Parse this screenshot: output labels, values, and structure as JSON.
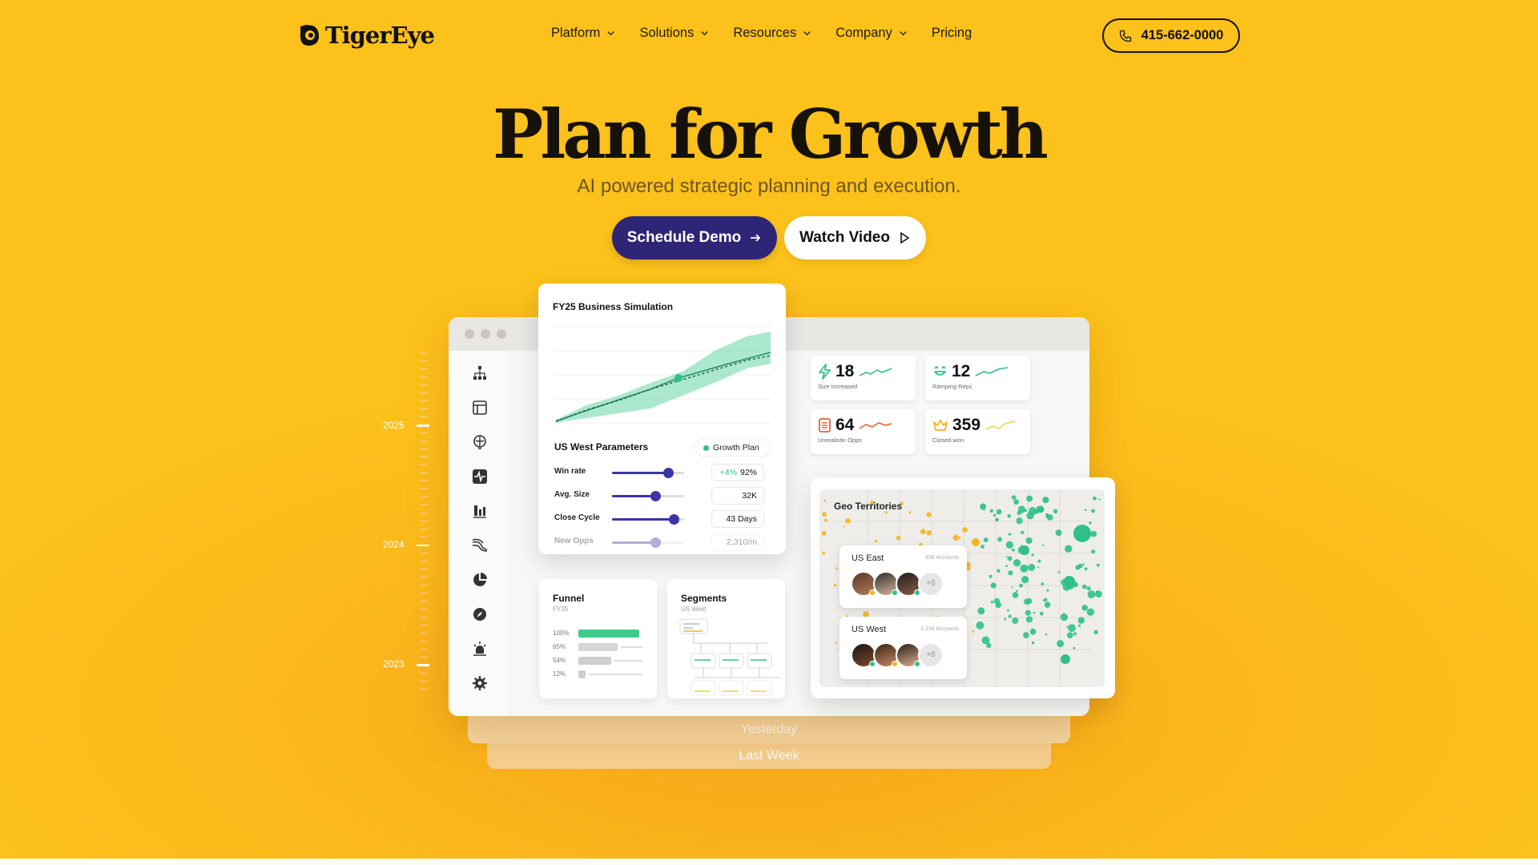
{
  "brand": {
    "name": "TigerEye"
  },
  "nav": {
    "items": [
      {
        "label": "Platform",
        "has_dropdown": true
      },
      {
        "label": "Solutions",
        "has_dropdown": true
      },
      {
        "label": "Resources",
        "has_dropdown": true
      },
      {
        "label": "Company",
        "has_dropdown": true
      },
      {
        "label": "Pricing",
        "has_dropdown": false
      }
    ],
    "phone": "415-662-0000"
  },
  "hero": {
    "title": "Plan for Growth",
    "subtitle": "AI powered strategic planning and execution.",
    "primary_cta": "Schedule Demo",
    "secondary_cta": "Watch Video"
  },
  "timeline": {
    "years": [
      "2025",
      "2024",
      "2023"
    ]
  },
  "history": {
    "labels": [
      "Yesterday",
      "Last Week"
    ]
  },
  "simulation": {
    "title": "FY25 Business Simulation",
    "params_title": "US West Parameters",
    "legend": "Growth Plan",
    "params": [
      {
        "label": "Win rate",
        "delta": "+4%",
        "value": "92%",
        "level": 0.78
      },
      {
        "label": "Avg. Size",
        "delta": "",
        "value": "32K",
        "level": 0.6
      },
      {
        "label": "Close Cycle",
        "delta": "",
        "value": "43 Days",
        "level": 0.86
      },
      {
        "label": "New Opps",
        "delta": "",
        "value": "2,310/m",
        "level": 0.6
      }
    ]
  },
  "stats": [
    {
      "value": "18",
      "label": "Size increased",
      "icon": "lightning-icon",
      "color": "#2fc08a"
    },
    {
      "value": "12",
      "label": "Ramping Reps",
      "icon": "smile-icon",
      "color": "#2fc08a"
    },
    {
      "value": "64",
      "label": "Unrealistic Opps",
      "icon": "document-icon",
      "color": "#e8642c"
    },
    {
      "value": "359",
      "label": "Closed won",
      "icon": "crown-icon",
      "color": "#f2b51c"
    }
  ],
  "funnel": {
    "title": "Funnel",
    "subtitle": "FY25",
    "rows": [
      {
        "label": "100%",
        "fraction": 1.0
      },
      {
        "label": "65%",
        "fraction": 0.65
      },
      {
        "label": "54%",
        "fraction": 0.54
      },
      {
        "label": "12%",
        "fraction": 0.12
      }
    ]
  },
  "segments": {
    "title": "Segments",
    "subtitle": "US West"
  },
  "geo": {
    "title": "Geo Territories",
    "regions": [
      {
        "name": "US East",
        "accounts": "938 Accounts",
        "more": "+6"
      },
      {
        "name": "US West",
        "accounts": "1,234 Accounts",
        "more": "+8"
      }
    ]
  },
  "colors": {
    "accent_green": "#2fc08a",
    "accent_purple": "#2e2577",
    "background": "#fcc11b"
  }
}
